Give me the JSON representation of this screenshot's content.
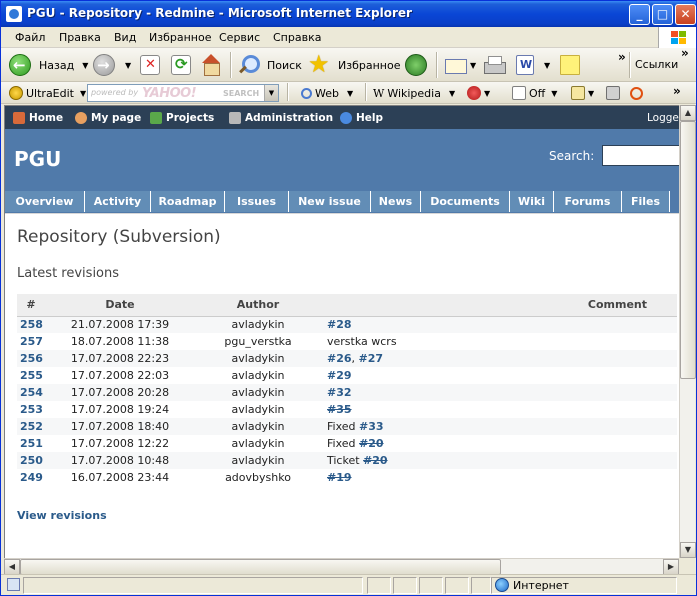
{
  "window": {
    "title": "PGU - Repository - Redmine - Microsoft Internet Explorer"
  },
  "menubar": {
    "items": [
      "Файл",
      "Правка",
      "Вид",
      "Избранное",
      "Сервис",
      "Справка"
    ]
  },
  "toolbar": {
    "back_label": "Назад",
    "search_label": "Поиск",
    "favorites_label": "Избранное",
    "links_label": "Ссылки"
  },
  "linksbar": {
    "ultraedit_label": "UltraEdit",
    "yahoo_powered": "powered by",
    "yahoo_brand": "YAHOO!",
    "yahoo_search": "SEARCH",
    "web_label": "Web",
    "wikipedia_label": "Wikipedia",
    "off_label": "Off"
  },
  "redmine": {
    "topmenu": [
      "Home",
      "My page",
      "Projects",
      "Administration",
      "Help"
    ],
    "logged": "Logge",
    "project": "PGU",
    "search_label": "Search:",
    "tabs": [
      "Overview",
      "Activity",
      "Roadmap",
      "Issues",
      "New issue",
      "News",
      "Documents",
      "Wiki",
      "Forums",
      "Files"
    ],
    "heading": "Repository (Subversion)",
    "subheading": "Latest revisions",
    "table": {
      "headers": [
        "#",
        "Date",
        "Author",
        "Comment"
      ],
      "rows": [
        {
          "rev": "258",
          "date": "21.07.2008 17:39",
          "author": "avladykin",
          "comment_prefix": "",
          "issues": [
            {
              "id": "#28",
              "closed": false
            }
          ]
        },
        {
          "rev": "257",
          "date": "18.07.2008 11:38",
          "author": "pgu_verstka",
          "comment_prefix": "verstka wcrs",
          "issues": []
        },
        {
          "rev": "256",
          "date": "17.07.2008 22:23",
          "author": "avladykin",
          "comment_prefix": "",
          "issues": [
            {
              "id": "#26",
              "closed": false
            },
            {
              "id": "#27",
              "closed": false
            }
          ]
        },
        {
          "rev": "255",
          "date": "17.07.2008 22:03",
          "author": "avladykin",
          "comment_prefix": "",
          "issues": [
            {
              "id": "#29",
              "closed": false
            }
          ]
        },
        {
          "rev": "254",
          "date": "17.07.2008 20:28",
          "author": "avladykin",
          "comment_prefix": "",
          "issues": [
            {
              "id": "#32",
              "closed": false
            }
          ]
        },
        {
          "rev": "253",
          "date": "17.07.2008 19:24",
          "author": "avladykin",
          "comment_prefix": "",
          "issues": [
            {
              "id": "#35",
              "closed": true
            }
          ]
        },
        {
          "rev": "252",
          "date": "17.07.2008 18:40",
          "author": "avladykin",
          "comment_prefix": "Fixed",
          "issues": [
            {
              "id": "#33",
              "closed": false
            }
          ]
        },
        {
          "rev": "251",
          "date": "17.07.2008 12:22",
          "author": "avladykin",
          "comment_prefix": "Fixed",
          "issues": [
            {
              "id": "#20",
              "closed": true
            }
          ]
        },
        {
          "rev": "250",
          "date": "17.07.2008 10:48",
          "author": "avladykin",
          "comment_prefix": "Ticket",
          "issues": [
            {
              "id": "#20",
              "closed": true
            }
          ]
        },
        {
          "rev": "249",
          "date": "16.07.2008 23:44",
          "author": "adovbyshko",
          "comment_prefix": "",
          "issues": [
            {
              "id": "#19",
              "closed": true
            }
          ]
        }
      ]
    },
    "view_revisions": "View revisions"
  },
  "statusbar": {
    "zone": "Интернет"
  }
}
